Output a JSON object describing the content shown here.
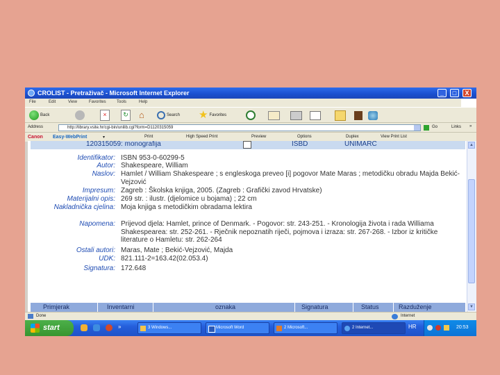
{
  "window": {
    "title": "CROLIST - Pretraživač - Microsoft Internet Explorer",
    "buttons": [
      "_",
      "□",
      "X"
    ]
  },
  "menu": [
    "File",
    "Edit",
    "View",
    "Favorites",
    "Tools",
    "Help"
  ],
  "toolbar": {
    "back": "Back",
    "search": "Search",
    "favorites": "Favorites"
  },
  "address": {
    "label": "Address",
    "url": "http://library.vsite.hr/cgi-bin/unilib.cgi?form=D1120315059",
    "go": "Go",
    "links": "Links"
  },
  "canon_bar": {
    "brand": "Canon",
    "product": "Easy-WebPrint",
    "items": [
      "Print",
      "High Speed Print",
      "Preview",
      "Options",
      "Duplex",
      "View Print List"
    ]
  },
  "record": {
    "header_id": "120315059: monografija",
    "header_isbd": "ISBD",
    "header_unimarc": "UNIMARC",
    "fields": [
      {
        "label": "Identifikator:",
        "value": "ISBN 953-0-60299-5"
      },
      {
        "label": "Autor:",
        "value": "Shakespeare, William"
      },
      {
        "label": "Naslov:",
        "value": "Hamlet / William Shakespeare ; s engleskoga preveo [i] pogovor Mate Maras ; metodičku obradu Majda Bekić-Vejzović"
      },
      {
        "label": "Impresum:",
        "value": "Zagreb : Školska knjiga, 2005. (Zagreb : Grafički zavod Hrvatske)"
      },
      {
        "label": "Materijalni opis:",
        "value": "269 str. : ilustr. (djelomice u bojama) ; 22 cm"
      },
      {
        "label": "Nakladnička cjelina:",
        "value": "Moja knjiga s metodičkim obradama lektira"
      },
      {
        "label": "Napomena:",
        "value": "Prijevod djela: Hamlet, prince of Denmark. - Pogovor: str. 243-251. - Kronologija života i rada Williama Shakespearea: str. 252-261. - Rječnik nepoznatih riječi, pojmova i izraza: str. 267-268. - Izbor iz kritičke literature o Hamletu: str. 262-264"
      },
      {
        "label": "Ostali autori:",
        "value": "Maras, Mate ; Bekić-Vejzović, Majda"
      },
      {
        "label": "UDK:",
        "value": "821.111-2=163.42(02.053.4)"
      },
      {
        "label": "Signatura:",
        "value": "172.648"
      }
    ],
    "table_headers": [
      "Primjerak",
      "Inventarni",
      "oznaka",
      "Signatura",
      "Status",
      "Razduženje"
    ]
  },
  "statusbar": {
    "done": "Done",
    "zone": "Internet"
  },
  "taskbar": {
    "start": "start",
    "tasks": [
      "3 Windows...",
      "Microsoft Word",
      "2 Microsoft...",
      "2 Internet..."
    ],
    "lang": "HR",
    "clock": "20:53"
  }
}
